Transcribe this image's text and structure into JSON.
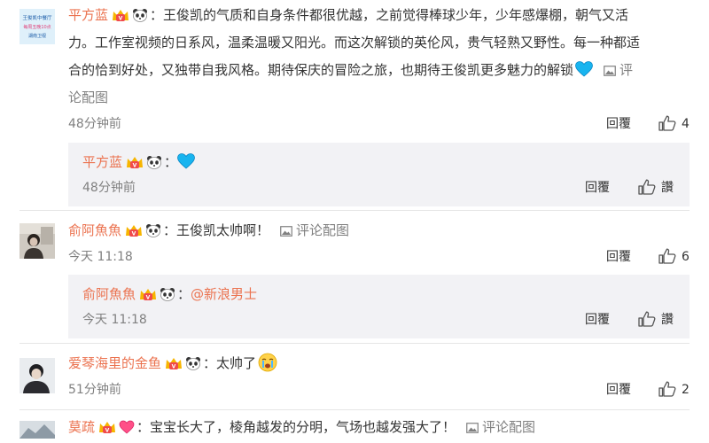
{
  "comments": [
    {
      "name": "平方蓝",
      "text_lines": [
        "：王俊凯的气质和自身条件都很优越，之前觉得棒球少年，少年感爆棚，朝气又活",
        "力。工作室视频的日系风，温柔温暖又阳光。而这次解锁的英伦风，贵气轻熟又野性。每一种都适",
        "合的恰到好处，又独带自我风格。期待保庆的冒险之旅，也期待王俊凯更多魅力的解锁"
      ],
      "img_link_a": "评",
      "img_link_b": "论配图",
      "time": "48分钟前",
      "reply": "回覆",
      "likes": "4",
      "avatar_lines": [
        "王俊凯中餐厅",
        "每周五晚10点",
        "湖南卫视"
      ],
      "sub": {
        "name": "平方蓝",
        "colon": "：",
        "time": "48分钟前",
        "reply": "回覆",
        "likes": "讚"
      }
    },
    {
      "name": "俞阿魚魚",
      "text": "：王俊凯太帅啊！",
      "img_link": "评论配图",
      "time": "今天 11:18",
      "reply": "回覆",
      "likes": "6",
      "sub": {
        "name": "俞阿魚魚",
        "colon": "：",
        "mention": "@新浪男士",
        "time": "今天 11:18",
        "reply": "回覆",
        "likes": "讚"
      }
    },
    {
      "name": "爱琴海里的金鱼",
      "text": "：太帅了",
      "time": "51分钟前",
      "reply": "回覆",
      "likes": "2"
    },
    {
      "name": "莫疏",
      "text": "：宝宝长大了，棱角越发的分明，气场也越发强大了！",
      "img_link": "评论配图"
    }
  ],
  "icons": {
    "badge_vip": "vip-crown-icon",
    "badge_panda": "panda-icon",
    "heart": "blue-heart-icon",
    "image": "image-icon",
    "like": "thumb-up-icon",
    "crying": "crying-emoji-icon"
  },
  "colors": {
    "name": "#eb7350",
    "meta": "#808080",
    "subbg": "#f2f2f5",
    "heart": "#18b4ef"
  }
}
